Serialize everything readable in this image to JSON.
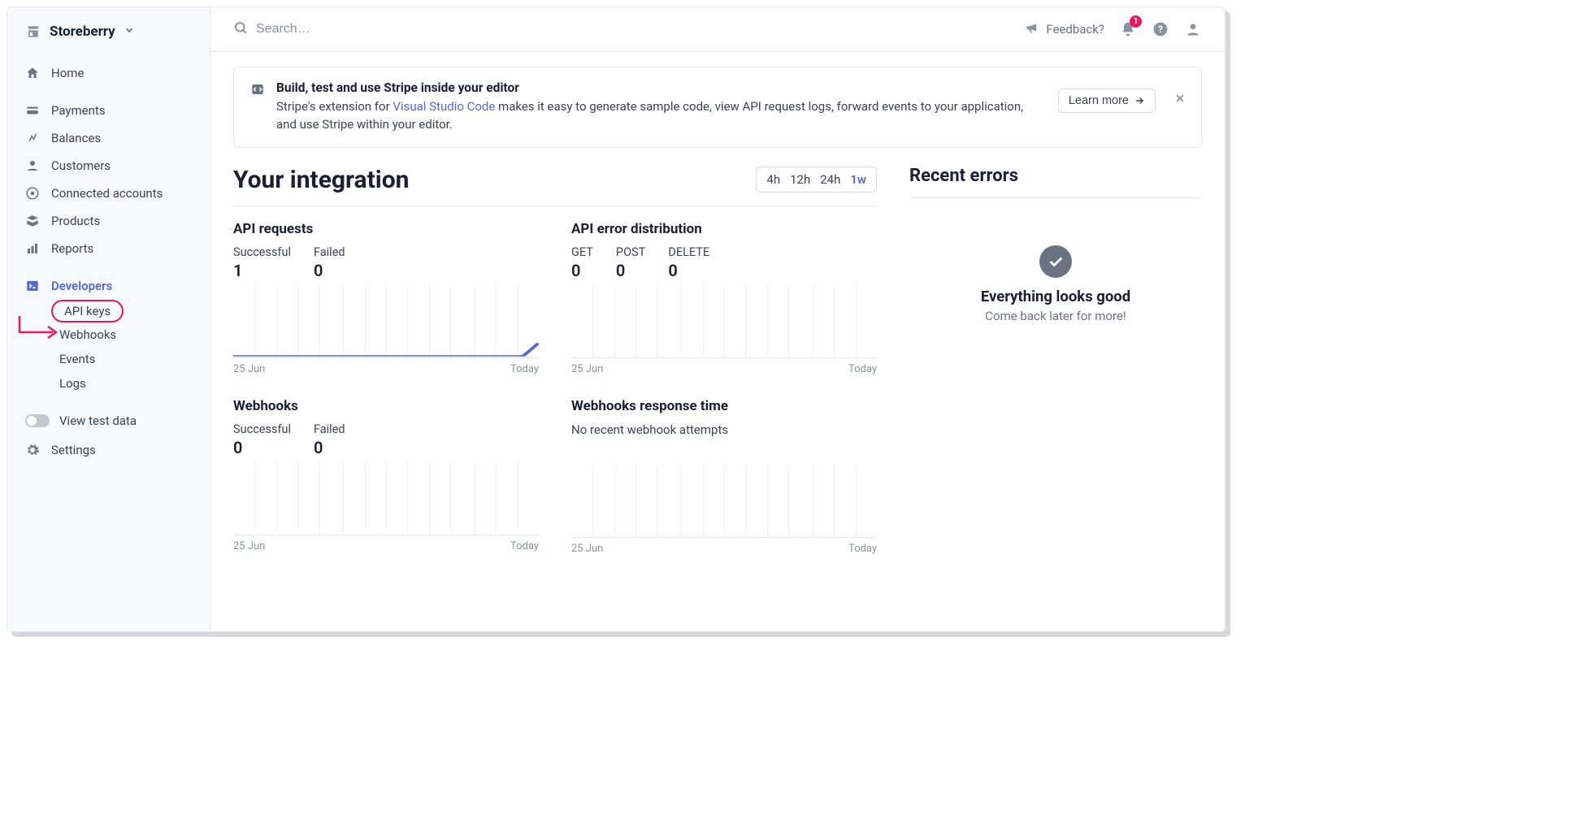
{
  "account": {
    "name": "Storeberry"
  },
  "sidebar": {
    "items": [
      {
        "label": "Home",
        "icon": "home-icon"
      },
      {
        "label": "Payments",
        "icon": "payments-icon"
      },
      {
        "label": "Balances",
        "icon": "balances-icon"
      },
      {
        "label": "Customers",
        "icon": "customers-icon"
      },
      {
        "label": "Connected accounts",
        "icon": "connected-icon"
      },
      {
        "label": "Products",
        "icon": "products-icon"
      },
      {
        "label": "Reports",
        "icon": "reports-icon"
      }
    ],
    "developers": {
      "label": "Developers",
      "sub": [
        {
          "label": "API keys"
        },
        {
          "label": "Webhooks"
        },
        {
          "label": "Events"
        },
        {
          "label": "Logs"
        }
      ]
    },
    "test_toggle": "View test data",
    "settings": "Settings"
  },
  "topbar": {
    "search_placeholder": "Search…",
    "feedback": "Feedback?",
    "notification_count": "1"
  },
  "banner": {
    "title": "Build, test and use Stripe inside your editor",
    "text_before_link": "Stripe's extension for ",
    "link_text": "Visual Studio Code",
    "text_after_link": " makes it easy to generate sample code, view API request logs, forward events to your application, and use Stripe within your editor.",
    "learn_more": "Learn more"
  },
  "integration": {
    "title": "Your integration",
    "time_ranges": [
      "4h",
      "12h",
      "24h",
      "1w"
    ],
    "time_active": "1w",
    "widgets": {
      "api_requests": {
        "title": "API requests",
        "metrics": [
          {
            "label": "Successful",
            "value": "1"
          },
          {
            "label": "Failed",
            "value": "0"
          }
        ],
        "axis": {
          "start": "25 Jun",
          "end": "Today"
        }
      },
      "api_errors": {
        "title": "API error distribution",
        "metrics": [
          {
            "label": "GET",
            "value": "0"
          },
          {
            "label": "POST",
            "value": "0"
          },
          {
            "label": "DELETE",
            "value": "0"
          }
        ],
        "axis": {
          "start": "25 Jun",
          "end": "Today"
        }
      },
      "webhooks": {
        "title": "Webhooks",
        "metrics": [
          {
            "label": "Successful",
            "value": "0"
          },
          {
            "label": "Failed",
            "value": "0"
          }
        ],
        "axis": {
          "start": "25 Jun",
          "end": "Today"
        }
      },
      "webhook_response": {
        "title": "Webhooks response time",
        "note": "No recent webhook attempts",
        "axis": {
          "start": "25 Jun",
          "end": "Today"
        }
      }
    }
  },
  "recent_errors": {
    "title": "Recent errors",
    "ok_title": "Everything looks good",
    "ok_sub": "Come back later for more!"
  },
  "chart_data": [
    {
      "id": "api_requests",
      "type": "line",
      "x_range": [
        "25 Jun",
        "Today"
      ],
      "series": [
        {
          "name": "Successful",
          "values_flat_then_spike_at_end": true,
          "baseline": 0,
          "final_value": 1
        },
        {
          "name": "Failed",
          "values_constant": 0
        }
      ]
    },
    {
      "id": "api_errors",
      "type": "bar",
      "x_range": [
        "25 Jun",
        "Today"
      ],
      "series": [],
      "empty": true
    },
    {
      "id": "webhooks",
      "type": "line",
      "x_range": [
        "25 Jun",
        "Today"
      ],
      "series": [],
      "empty": true
    },
    {
      "id": "webhook_response",
      "type": "line",
      "x_range": [
        "25 Jun",
        "Today"
      ],
      "series": [],
      "empty": true
    }
  ]
}
